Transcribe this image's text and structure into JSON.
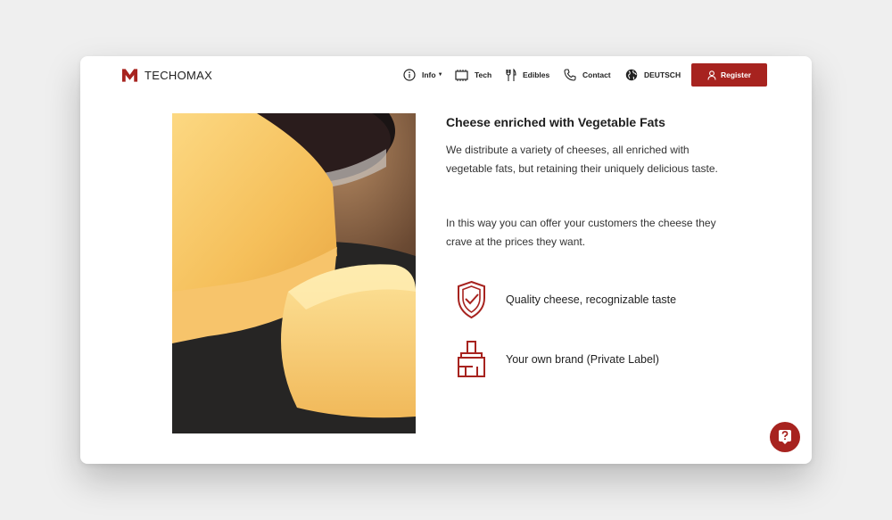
{
  "brand": {
    "name": "TECHOMAX",
    "accent_color": "#a7231f"
  },
  "nav": {
    "items": [
      {
        "label": "Info",
        "icon": "info-icon",
        "has_dropdown": true
      },
      {
        "label": "Tech",
        "icon": "chip-icon"
      },
      {
        "label": "Edibles",
        "icon": "utensils-icon"
      },
      {
        "label": "Contact",
        "icon": "phone-icon"
      },
      {
        "label": "DEUTSCH",
        "icon": "globe-icon"
      }
    ],
    "register_label": "Register"
  },
  "content": {
    "title": "Cheese enriched with Vegetable Fats",
    "paragraph_1": "We distribute a variety of cheeses, all enriched with vegetable fats, but retaining their uniquely delicious taste.",
    "paragraph_2": "In this way you can offer your customers the cheese they crave at the prices they want.",
    "features": [
      {
        "icon": "shield-check-icon",
        "label": "Quality cheese, recognizable taste"
      },
      {
        "icon": "paint-brush-icon",
        "label": "Your own brand (Private Label)"
      }
    ]
  },
  "help_button": {
    "icon": "question-icon"
  }
}
